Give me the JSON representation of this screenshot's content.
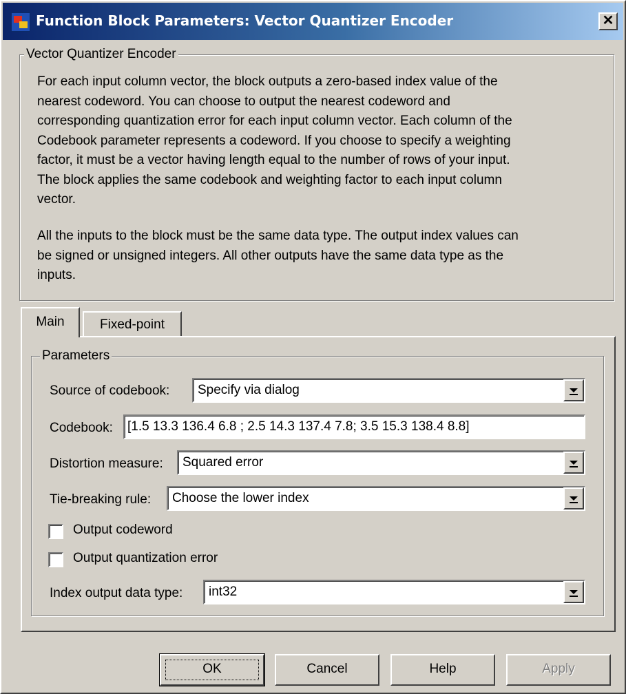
{
  "window": {
    "title": "Function Block Parameters: Vector Quantizer Encoder",
    "close_glyph": "✕"
  },
  "description": {
    "group_title": "Vector Quantizer Encoder",
    "paragraph1_lines": [
      "For each input column vector, the block outputs a zero-based index value of the",
      "nearest codeword. You can choose to output the nearest codeword and",
      "corresponding quantization error for each input column vector. Each column of the",
      "Codebook parameter represents a codeword. If you choose to specify a weighting",
      "factor, it must be a vector having length equal to the number of rows of your input.",
      "The block applies the same codebook and weighting factor to each input column",
      "vector."
    ],
    "paragraph2_lines": [
      "All the inputs to the block must be the same data type. The output index values can",
      "be signed or unsigned integers. All other outputs have the same data type as the",
      "inputs."
    ]
  },
  "tabs": [
    {
      "label": "Main",
      "selected": true
    },
    {
      "label": "Fixed-point",
      "selected": false
    }
  ],
  "parameters": {
    "group_title": "Parameters",
    "source_of_codebook": {
      "label": "Source of codebook:",
      "value": "Specify via dialog"
    },
    "codebook": {
      "label": "Codebook:",
      "value": "[1.5  13.3  136.4  6.8 ; 2.5  14.3  137.4  7.8; 3.5  15.3  138.4  8.8]"
    },
    "distortion_measure": {
      "label": "Distortion measure:",
      "value": "Squared error"
    },
    "tie_breaking_rule": {
      "label": "Tie-breaking rule:",
      "value": "Choose the lower index"
    },
    "output_codeword": {
      "label": "Output codeword",
      "checked": false
    },
    "output_quantization_error": {
      "label": "Output quantization error",
      "checked": false
    },
    "index_output_data_type": {
      "label": "Index output data type:",
      "value": "int32"
    }
  },
  "buttons": {
    "ok": "OK",
    "cancel": "Cancel",
    "help": "Help",
    "apply": "Apply"
  }
}
